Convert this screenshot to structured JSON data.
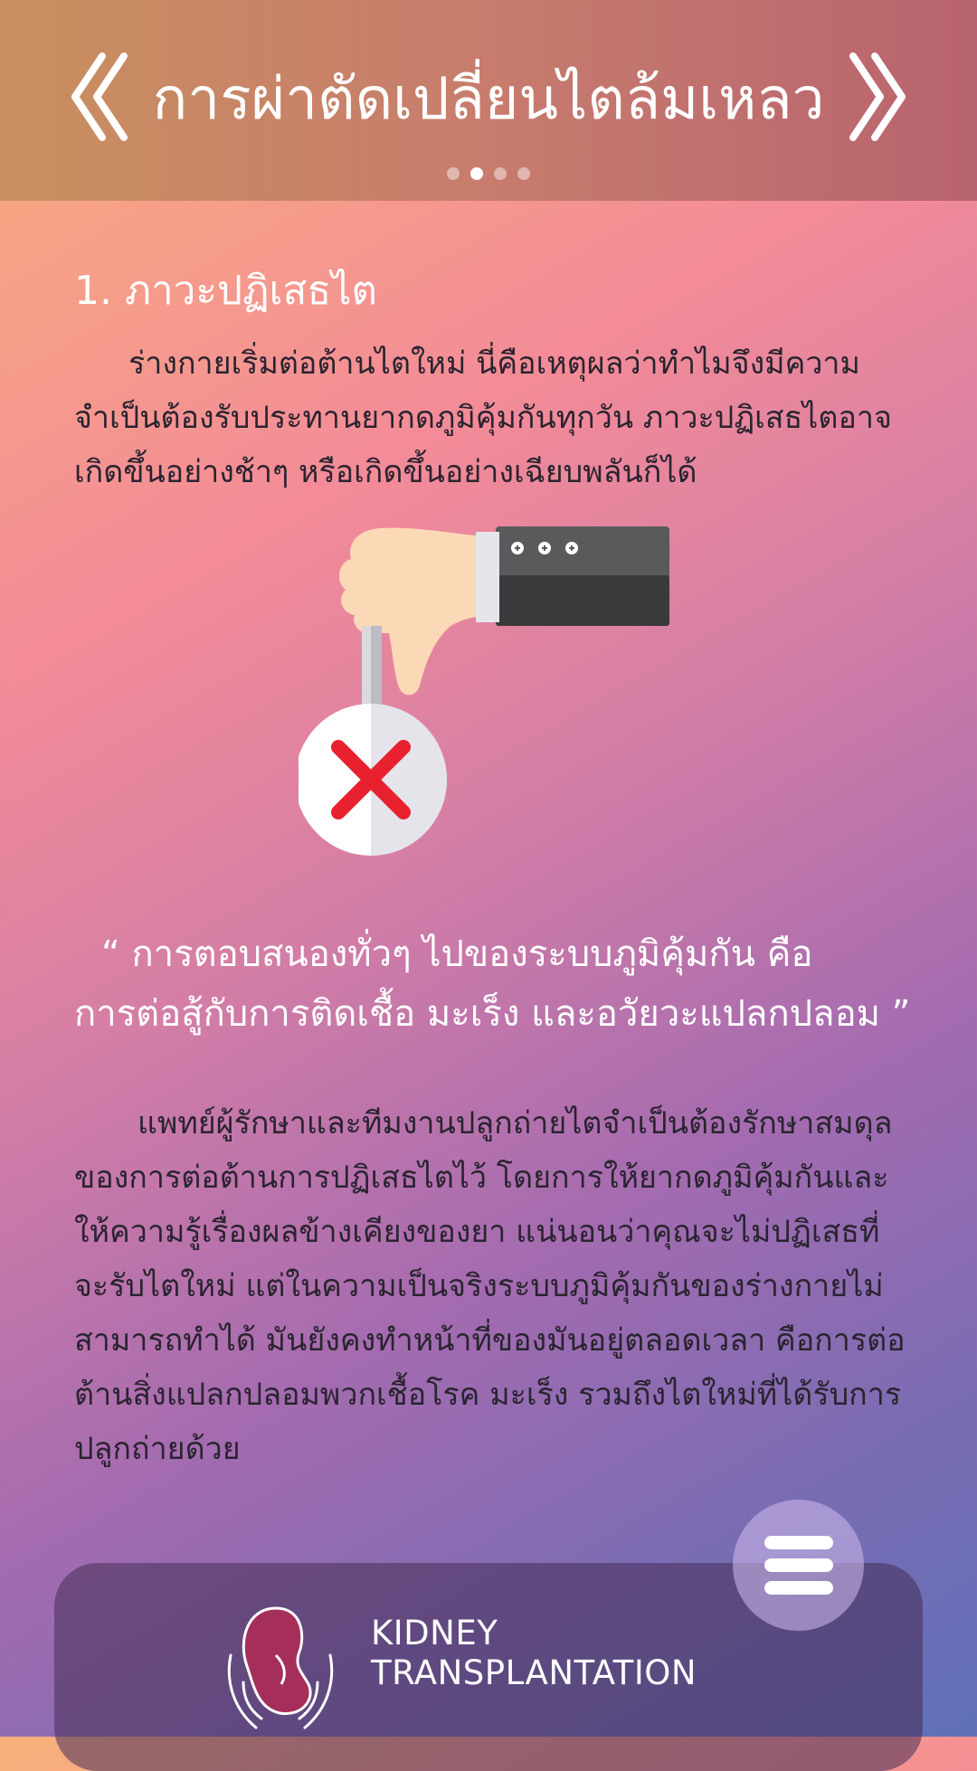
{
  "header": {
    "title": "การผ่าตัดเปลี่ยนไตล้มเหลว",
    "prev_icon": "chevron-double-left-icon",
    "next_icon": "chevron-double-right-icon",
    "pagination": {
      "total": 4,
      "active_index": 1
    }
  },
  "content": {
    "section_title": "1. ภาวะปฏิเสธไต",
    "paragraph1": "ร่างกายเริ่มต่อต้านไตใหม่ นี่คือเหตุผลว่าทำไมจึงมีความจำเป็นต้องรับประทานยากดภูมิคุ้มกันทุกวัน ภาวะปฏิเสธไตอาจเกิดขึ้นอย่างช้าๆ หรือเกิดขึ้นอย่างเฉียบพลันก็ได้",
    "quote_line1": "“ การตอบสนองทั่วๆ ไปของระบบภูมิคุ้มกัน คือ",
    "quote_line2": "การต่อสู้กับการติดเชื้อ มะเร็ง และอวัยวะแปลกปลอม ”",
    "paragraph2": "แพทย์ผู้รักษาและทีมงานปลูกถ่ายไตจำเป็นต้องรักษาสมดุลของการต่อต้านการปฏิเสธไตไว้ โดยการให้ยากดภูมิคุ้มกันและให้ความรู้เรื่องผลข้างเคียงของยา แน่นอนว่าคุณจะไม่ปฏิเสธที่จะรับไตใหม่ แต่ในความเป็นจริงระบบภูมิคุ้มกันของร่างกายไม่สามารถทำได้ มันยังคงทำหน้าที่ของมันอยู่ตลอดเวลา คือการต่อต้านสิ่งแปลกปลอมพวกเชื้อโรค มะเร็ง รวมถึงไตใหม่ที่ได้รับการปลูกถ่ายด้วย",
    "illustration_icon": "thumbs-down-reject-icon"
  },
  "footer": {
    "brand_line1": "KIDNEY",
    "brand_line2": "TRANSPLANTATION",
    "logo_icon": "kidney-in-hands-icon",
    "menu_icon": "hamburger-menu-icon"
  },
  "colors": {
    "reject_red": "#e8212e",
    "header_left": "#c98f5f",
    "header_right": "#b8636f"
  }
}
